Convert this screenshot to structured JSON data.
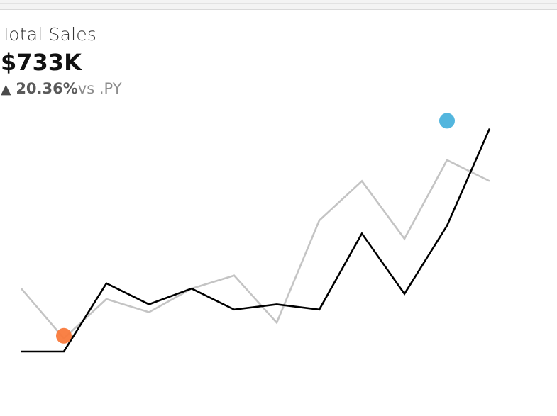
{
  "kpi": {
    "title": "Total Sales",
    "value": "$733K",
    "delta_arrow": "▲",
    "delta_pct": "20.36%",
    "delta_suffix": "vs .PY"
  },
  "colors": {
    "current": "#000000",
    "previous": "#c4c4c4",
    "min_marker": "#f97a3c",
    "max_marker": "#4ab2dc"
  },
  "chart_data": {
    "type": "line",
    "x": [
      1,
      2,
      3,
      4,
      5,
      6,
      7,
      8,
      9,
      10,
      11,
      12
    ],
    "series": [
      {
        "role": "current",
        "values": [
          10,
          10,
          36,
          28,
          34,
          26,
          28,
          26,
          55,
          32,
          58,
          95
        ]
      },
      {
        "role": "previous",
        "values": [
          34,
          15,
          30,
          25,
          34,
          39,
          21,
          60,
          75,
          53,
          83,
          75
        ]
      }
    ],
    "ylim": [
      0,
      100
    ],
    "markers": [
      {
        "type": "min",
        "x": 2,
        "y": 16
      },
      {
        "type": "max",
        "x": 11,
        "y": 98
      }
    ],
    "axes_visible": false,
    "grid": false
  }
}
